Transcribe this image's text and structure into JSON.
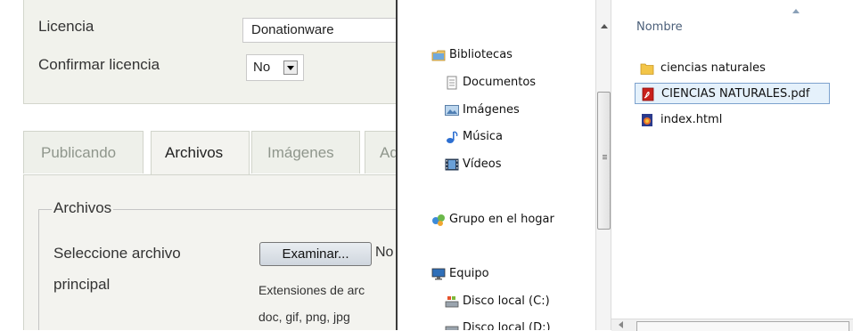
{
  "form": {
    "license_label": "Licencia",
    "license_value": "Donationware",
    "confirm_label": "Confirmar licencia",
    "confirm_value": "No",
    "tabs": [
      "Publicando",
      "Archivos",
      "Imágenes",
      "Ad"
    ],
    "active_tab": "Archivos",
    "fieldset_legend": "Archivos",
    "select_file_label_line1": "Seleccione archivo",
    "select_file_label_line2": "principal",
    "browse_button": "Examinar...",
    "no_file_text": "No",
    "extensions_line1": "Extensiones de arc",
    "extensions_line2": "doc, gif, png, jpg"
  },
  "dialog": {
    "column_header": "Nombre",
    "nav": {
      "libraries": "Bibliotecas",
      "documents": "Documentos",
      "images": "Imágenes",
      "music": "Música",
      "videos": "Vídeos",
      "homegroup": "Grupo en el hogar",
      "computer": "Equipo",
      "disk_c": "Disco local (C:)",
      "disk_d": "Disco local (D:)"
    },
    "files": [
      {
        "name": "ciencias naturales",
        "icon": "folder-icon"
      },
      {
        "name": "CIENCIAS NATURALES.pdf",
        "icon": "pdf-icon",
        "selected": true
      },
      {
        "name": "index.html",
        "icon": "html-file-icon"
      }
    ]
  },
  "colors": {
    "panel_bg": "#f1f2ec",
    "selection_bg": "#e5f1fb",
    "selection_border": "#7da2ce",
    "header_text": "#4c607a"
  }
}
